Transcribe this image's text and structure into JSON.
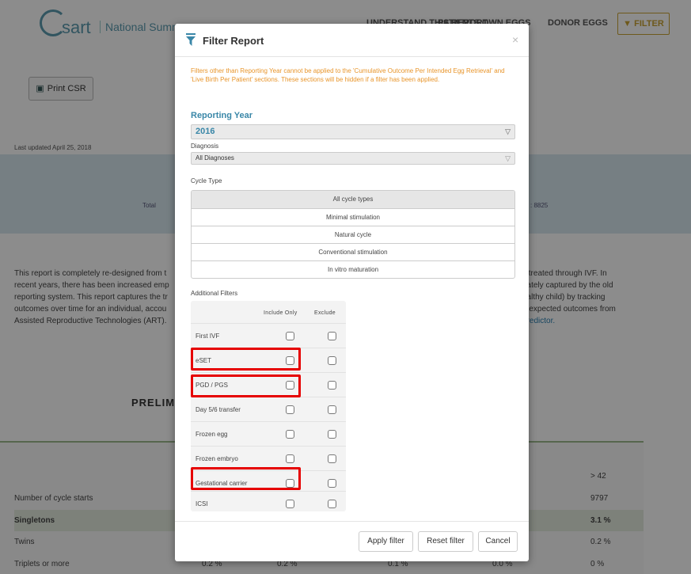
{
  "header": {
    "logo_text": "sart",
    "site_title": "National Summary",
    "nav": [
      "UNDERSTAND THIS REPORT",
      "PATIENTS OWN EGGS",
      "DONOR EGGS"
    ],
    "filter_label": "FILTER"
  },
  "page": {
    "print_label": "Print CSR",
    "last_updated": "Last updated April 25, 2018",
    "band_left_text": "Total",
    "band_right_text": ": 8825",
    "intro_left": [
      "This report is completely re-designed from t",
      "recent years, there has been increased emp",
      "reporting system. This report captures the tr",
      "outcomes over time for an individual, accou",
      "Assisted Reproductive Technologies (ART)."
    ],
    "intro_right": [
      "s treated through IVF. In",
      "uately captured by the old",
      "ealthy child) by tracking",
      "e expected outcomes from",
      "predictor."
    ],
    "prelim": "PRELIM",
    "table": {
      "header_last": "> 42",
      "rows": [
        {
          "label": "Number of cycle starts",
          "value": "9797",
          "cells": []
        },
        {
          "label": "Singletons",
          "value": "3.1 %",
          "cells": []
        },
        {
          "label": "Twins",
          "value": "0.2 %",
          "cells": []
        },
        {
          "label": "Triplets or more",
          "value": "0 %",
          "cells": [
            "0.2 %",
            "0.2 %",
            "0.1 %",
            "0.0 %"
          ]
        }
      ]
    }
  },
  "modal": {
    "title": "Filter Report",
    "close": "×",
    "warning": "Filters other than Reporting Year cannot be applied to the 'Cumulative Outcome Per Intended Egg Retrieval' and 'Live Birth Per Patient' sections. These sections will be hidden if a filter has been applied.",
    "reporting_year_label": "Reporting Year",
    "reporting_year_value": "2016",
    "diagnosis_label": "Diagnosis",
    "diagnosis_value": "All Diagnoses",
    "cycle_type_label": "Cycle Type",
    "cycle_types": [
      "All cycle types",
      "Minimal stimulation",
      "Natural cycle",
      "Conventional stimulation",
      "In vitro maturation"
    ],
    "additional_filters_label": "Additional Filters",
    "col_include": "Include Only",
    "col_exclude": "Exclude",
    "filters": [
      "First IVF",
      "eSET",
      "PGD / PGS",
      "Day 5/6 transfer",
      "Frozen egg",
      "Frozen embryo",
      "Gestational carrier",
      "ICSI"
    ],
    "highlighted_filters": [
      "eSET",
      "PGD / PGS",
      "Gestational carrier"
    ],
    "apply_label": "Apply filter",
    "reset_label": "Reset filter",
    "cancel_label": "Cancel"
  },
  "colors": {
    "accent": "#3a87a8",
    "warning": "#e8952b",
    "filter_gold": "#c9a233",
    "highlight": "#e60000"
  }
}
